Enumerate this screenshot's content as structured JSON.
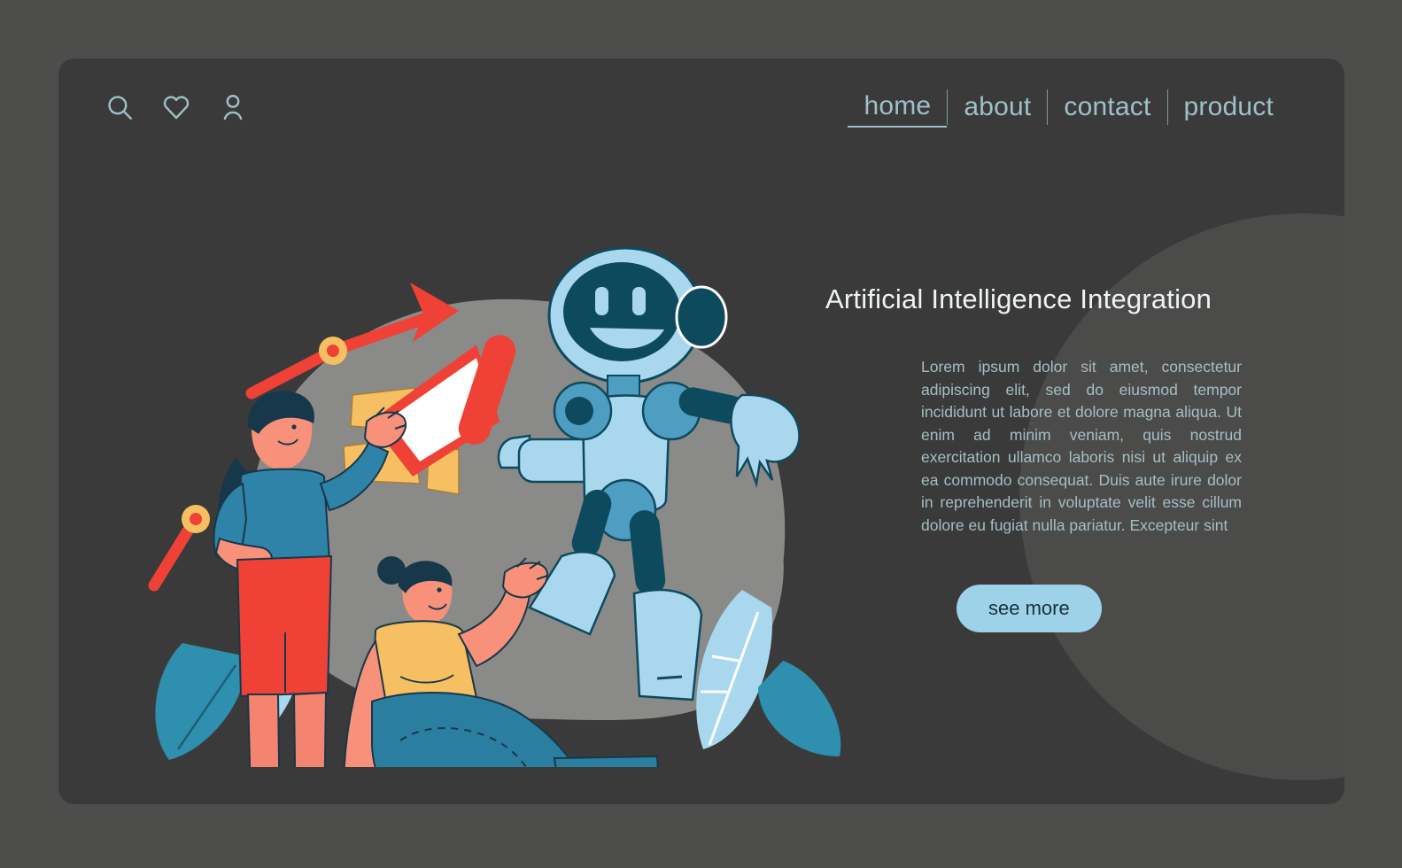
{
  "page": {
    "background_color": "#4d4d4c",
    "card_color": "#3a3a3a",
    "circle_color": "#4b4b4a",
    "accent_color": "#9ed2e8",
    "nav_color": "#9fc0c8"
  },
  "topbar": {
    "icons": [
      {
        "name": "search-icon",
        "label": "search"
      },
      {
        "name": "heart-icon",
        "label": "favorites"
      },
      {
        "name": "user-icon",
        "label": "account"
      }
    ],
    "nav": [
      {
        "label": "home",
        "active": true
      },
      {
        "label": "about",
        "active": false
      },
      {
        "label": "contact",
        "active": false
      },
      {
        "label": "product",
        "active": false
      }
    ],
    "separator": "|"
  },
  "hero": {
    "headline": "Artificial Intelligence Integration",
    "body": "Lorem ipsum dolor sit amet, consectetur adipiscing elit, sed do eiusmod tempor incididunt ut labore et dolore magna aliqua. Ut enim ad minim veniam, quis nostrud exercitation ullamco laboris nisi ut aliquip ex ea commodo consequat. Duis aute irure dolor in reprehenderit in voluptate velit esse cillum dolore eu fugiat nulla pariatur. Excepteur sint",
    "cta_label": "see more"
  },
  "illustration": {
    "name": "ai-integration-illustration",
    "description": "Two women and a friendly robot with a megaphone, growth arrow and leaves",
    "colors": {
      "blob": "#8a8a88",
      "robot_light": "#a9d8ee",
      "robot_mid": "#4e9ec2",
      "robot_dark": "#0e4a5e",
      "red": "#ef4136",
      "coral": "#f4846f",
      "skin": "#f79179",
      "yellow": "#f6bf62",
      "blue_top": "#2f82a8",
      "denim": "#2a7fa0",
      "leaf_light": "#a9d8ee",
      "leaf_dark": "#2f8fae",
      "ground": "#8e8e8c",
      "hair_dark": "#17384a",
      "white": "#ffffff"
    }
  }
}
